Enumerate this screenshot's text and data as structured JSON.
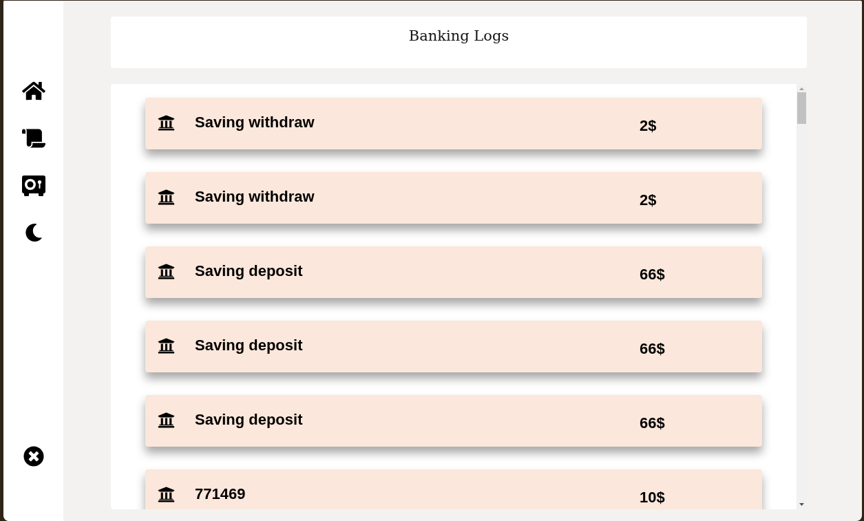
{
  "header": {
    "title": "Banking Logs"
  },
  "logs": [
    {
      "title": "Saving withdraw",
      "amount": "2$"
    },
    {
      "title": "Saving withdraw",
      "amount": "2$"
    },
    {
      "title": "Saving deposit",
      "amount": "66$"
    },
    {
      "title": "Saving deposit",
      "amount": "66$"
    },
    {
      "title": "Saving deposit",
      "amount": "66$"
    },
    {
      "title": "771469",
      "amount": "10$"
    }
  ]
}
